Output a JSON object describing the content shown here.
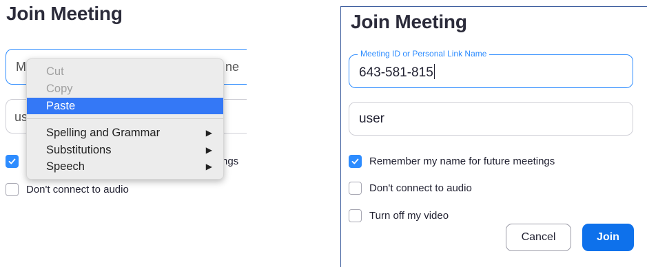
{
  "left": {
    "title": "Join Meeting",
    "id_field": {
      "visible_head": "M",
      "visible_tail": "ne"
    },
    "name_field": {
      "visible_head": "us"
    },
    "checkboxes": [
      {
        "label_tail": "ngs",
        "checked": true
      },
      {
        "label": "Don't connect to audio",
        "checked": false
      }
    ],
    "context_menu": {
      "items": [
        {
          "label": "Cut",
          "enabled": false
        },
        {
          "label": "Copy",
          "enabled": false
        },
        {
          "label": "Paste",
          "enabled": true,
          "highlighted": true
        },
        {
          "label": "Spelling and Grammar",
          "enabled": true,
          "submenu": true
        },
        {
          "label": "Substitutions",
          "enabled": true,
          "submenu": true
        },
        {
          "label": "Speech",
          "enabled": true,
          "submenu": true
        }
      ],
      "submenu_arrow": "▶"
    }
  },
  "right": {
    "title": "Join Meeting",
    "id_field": {
      "label": "Meeting ID or Personal Link Name",
      "value": "643-581-815"
    },
    "name_field": {
      "value": "user"
    },
    "checkboxes": [
      {
        "label": "Remember my name for future meetings",
        "checked": true
      },
      {
        "label": "Don't connect to audio",
        "checked": false
      },
      {
        "label": "Turn off my video",
        "checked": false
      }
    ],
    "buttons": {
      "cancel": "Cancel",
      "join": "Join"
    }
  },
  "colors": {
    "accent": "#2d8cff",
    "join_button": "#0e71eb",
    "menu_highlight": "#3478f6"
  }
}
